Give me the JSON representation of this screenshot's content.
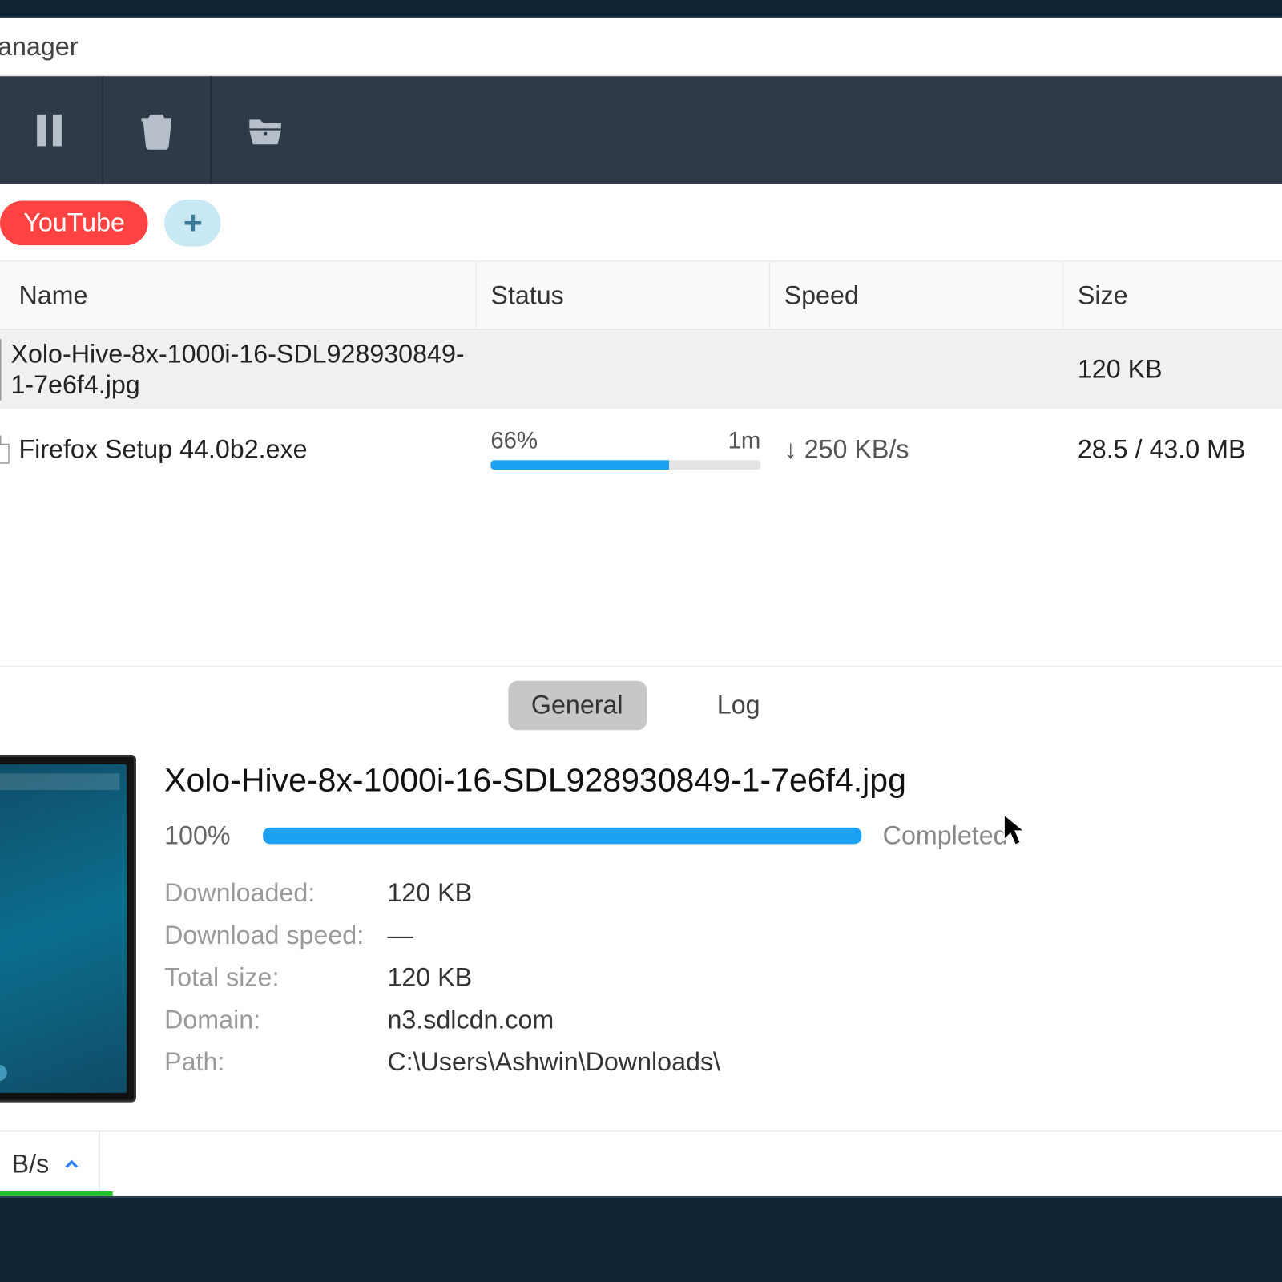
{
  "window": {
    "title_fragment": "anager"
  },
  "toolbar": {
    "pause_icon": "pause-icon",
    "delete_icon": "trash-icon",
    "openfolder_icon": "open-folder-icon"
  },
  "tags": {
    "youtube": "YouTube",
    "add": "+"
  },
  "columns": {
    "name": "Name",
    "status": "Status",
    "speed": "Speed",
    "size": "Size"
  },
  "rows": [
    {
      "name": "Xolo-Hive-8x-1000i-16-SDL928930849-1-7e6f4.jpg",
      "status_pct": "",
      "status_eta": "",
      "progress_pct": 100,
      "speed": "",
      "size": "120 KB",
      "selected": true,
      "icon": "image"
    },
    {
      "name": "Firefox Setup 44.0b2.exe",
      "status_pct": "66%",
      "status_eta": "1m",
      "progress_pct": 66,
      "speed": "↓ 250 KB/s",
      "size": "28.5 / 43.0 MB",
      "selected": false,
      "icon": "file"
    }
  ],
  "detailTabs": {
    "general": "General",
    "log": "Log",
    "active": "general"
  },
  "detail": {
    "title": "Xolo-Hive-8x-1000i-16-SDL928930849-1-7e6f4.jpg",
    "pct": "100%",
    "progress_pct": 100,
    "state": "Completed",
    "kv": {
      "downloaded_k": "Downloaded:",
      "downloaded_v": "120 KB",
      "speed_k": "Download speed:",
      "speed_v": "—",
      "total_k": "Total size:",
      "total_v": "120 KB",
      "domain_k": "Domain:",
      "domain_v": "n3.sdlcdn.com",
      "path_k": "Path:",
      "path_v": "C:\\Users\\Ashwin\\Downloads\\"
    }
  },
  "statusbar": {
    "rate_suffix": "B/s"
  },
  "colors": {
    "accent": "#1da1f2",
    "youtube": "#ff4242",
    "toolbar": "#2e3a47"
  }
}
